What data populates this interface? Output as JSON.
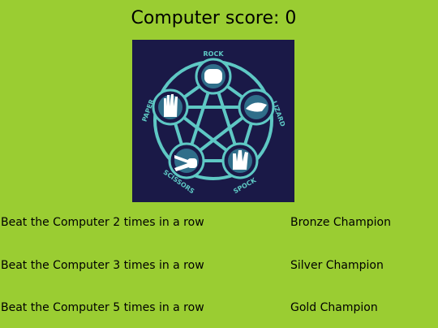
{
  "score": {
    "text": "Computer score: 0"
  },
  "image": {
    "labels": {
      "rock": "ROCK",
      "lizard": "LIZARD",
      "spock": "SPOCK",
      "scissors": "SCISSORS",
      "paper": "PAPER"
    }
  },
  "achievements": [
    {
      "description": "Beat the Computer 2 times in a row",
      "title": "Bronze Champion"
    },
    {
      "description": "Beat the Computer 3 times in a row",
      "title": "Silver Champion"
    },
    {
      "description": "Beat the Computer 5 times in a row",
      "title": "Gold Champion"
    }
  ],
  "colors": {
    "background": "#9acd32",
    "image_bg": "#1a1947",
    "accent": "#5ec8c4"
  }
}
